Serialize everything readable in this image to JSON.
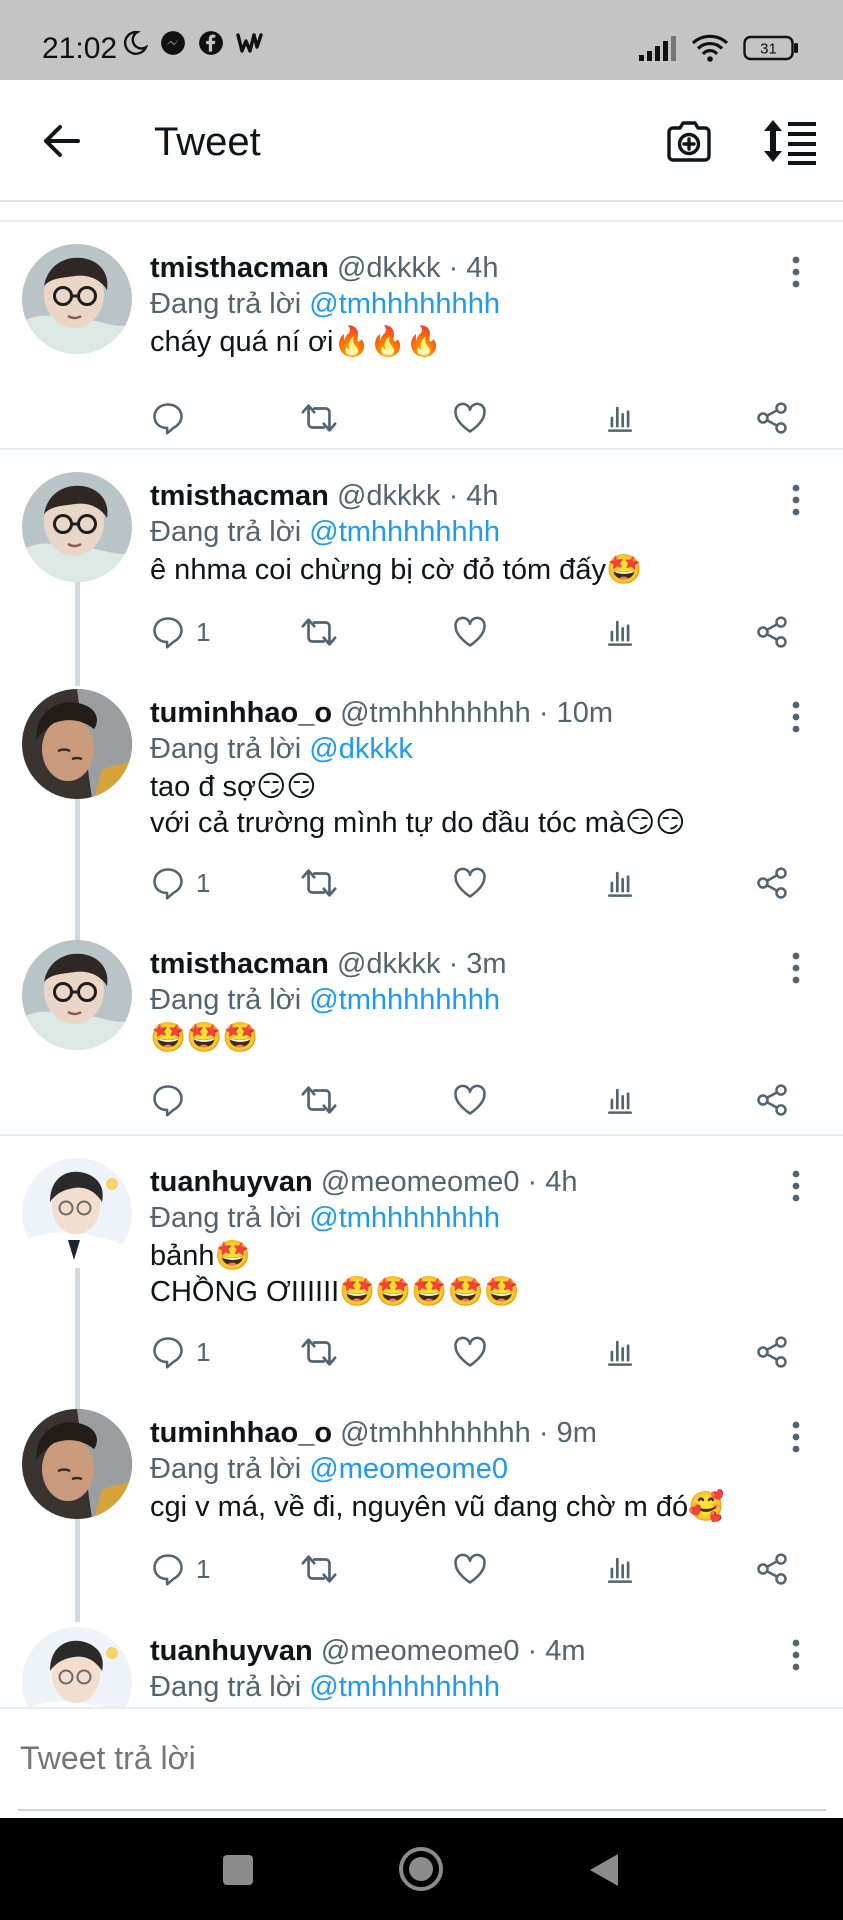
{
  "status_bar": {
    "time": "21:02",
    "left_icons": [
      "moon-icon",
      "messenger-icon",
      "facebook-icon",
      "wattpad-icon"
    ],
    "battery": "31"
  },
  "app_bar": {
    "title": "Tweet"
  },
  "tweets": [
    {
      "name": "tmisthacman",
      "meta": "@dkkkk · 4h",
      "reply_prefix": "Đang trả lời",
      "reply_to": "@tmhhhhhhhh",
      "text": "cháy quá ní ơi🔥🔥🔥",
      "reply_count": ""
    },
    {
      "name": "tmisthacman",
      "meta": "@dkkkk · 4h",
      "reply_prefix": "Đang trả lời",
      "reply_to": "@tmhhhhhhhh",
      "text": "ê nhma coi chừng bị cờ đỏ tóm đấy🤩",
      "reply_count": "1"
    },
    {
      "name": "tuminhhao_o",
      "meta": "@tmhhhhhhhh · 10m",
      "reply_prefix": "Đang trả lời",
      "reply_to": "@dkkkk",
      "text": "tao đ sợ😏😏\nvới cả trường mình tự do đầu tóc mà😏😏",
      "reply_count": "1"
    },
    {
      "name": "tmisthacman",
      "meta": "@dkkkk · 3m",
      "reply_prefix": "Đang trả lời",
      "reply_to": "@tmhhhhhhhh",
      "text": "🤩🤩🤩",
      "reply_count": ""
    },
    {
      "name": "tuanhuyvan",
      "meta": "@meomeome0 · 4h",
      "reply_prefix": "Đang trả lời",
      "reply_to": "@tmhhhhhhhh",
      "text": "bảnh🤩\nCHỒNG ƠIIIIII🤩🤩🤩🤩🤩",
      "reply_count": "1"
    },
    {
      "name": "tuminhhao_o",
      "meta": "@tmhhhhhhhh · 9m",
      "reply_prefix": "Đang trả lời",
      "reply_to": "@meomeome0",
      "text": "cgi v má, về đi, nguyên vũ đang chờ m đó🥰",
      "reply_count": "1"
    },
    {
      "name": "tuanhuyvan",
      "meta": "@meomeome0 · 4m",
      "reply_prefix": "Đang trả lời",
      "reply_to": "@tmhhhhhhhh",
      "text": "",
      "reply_count": ""
    }
  ],
  "compose": {
    "placeholder": "Tweet trả lời"
  },
  "colors": {
    "accent": "#1d9bf0",
    "secondary_text": "#536471",
    "status_bar_bg": "#c4c4c4",
    "nav_bar_bg": "#000000"
  }
}
